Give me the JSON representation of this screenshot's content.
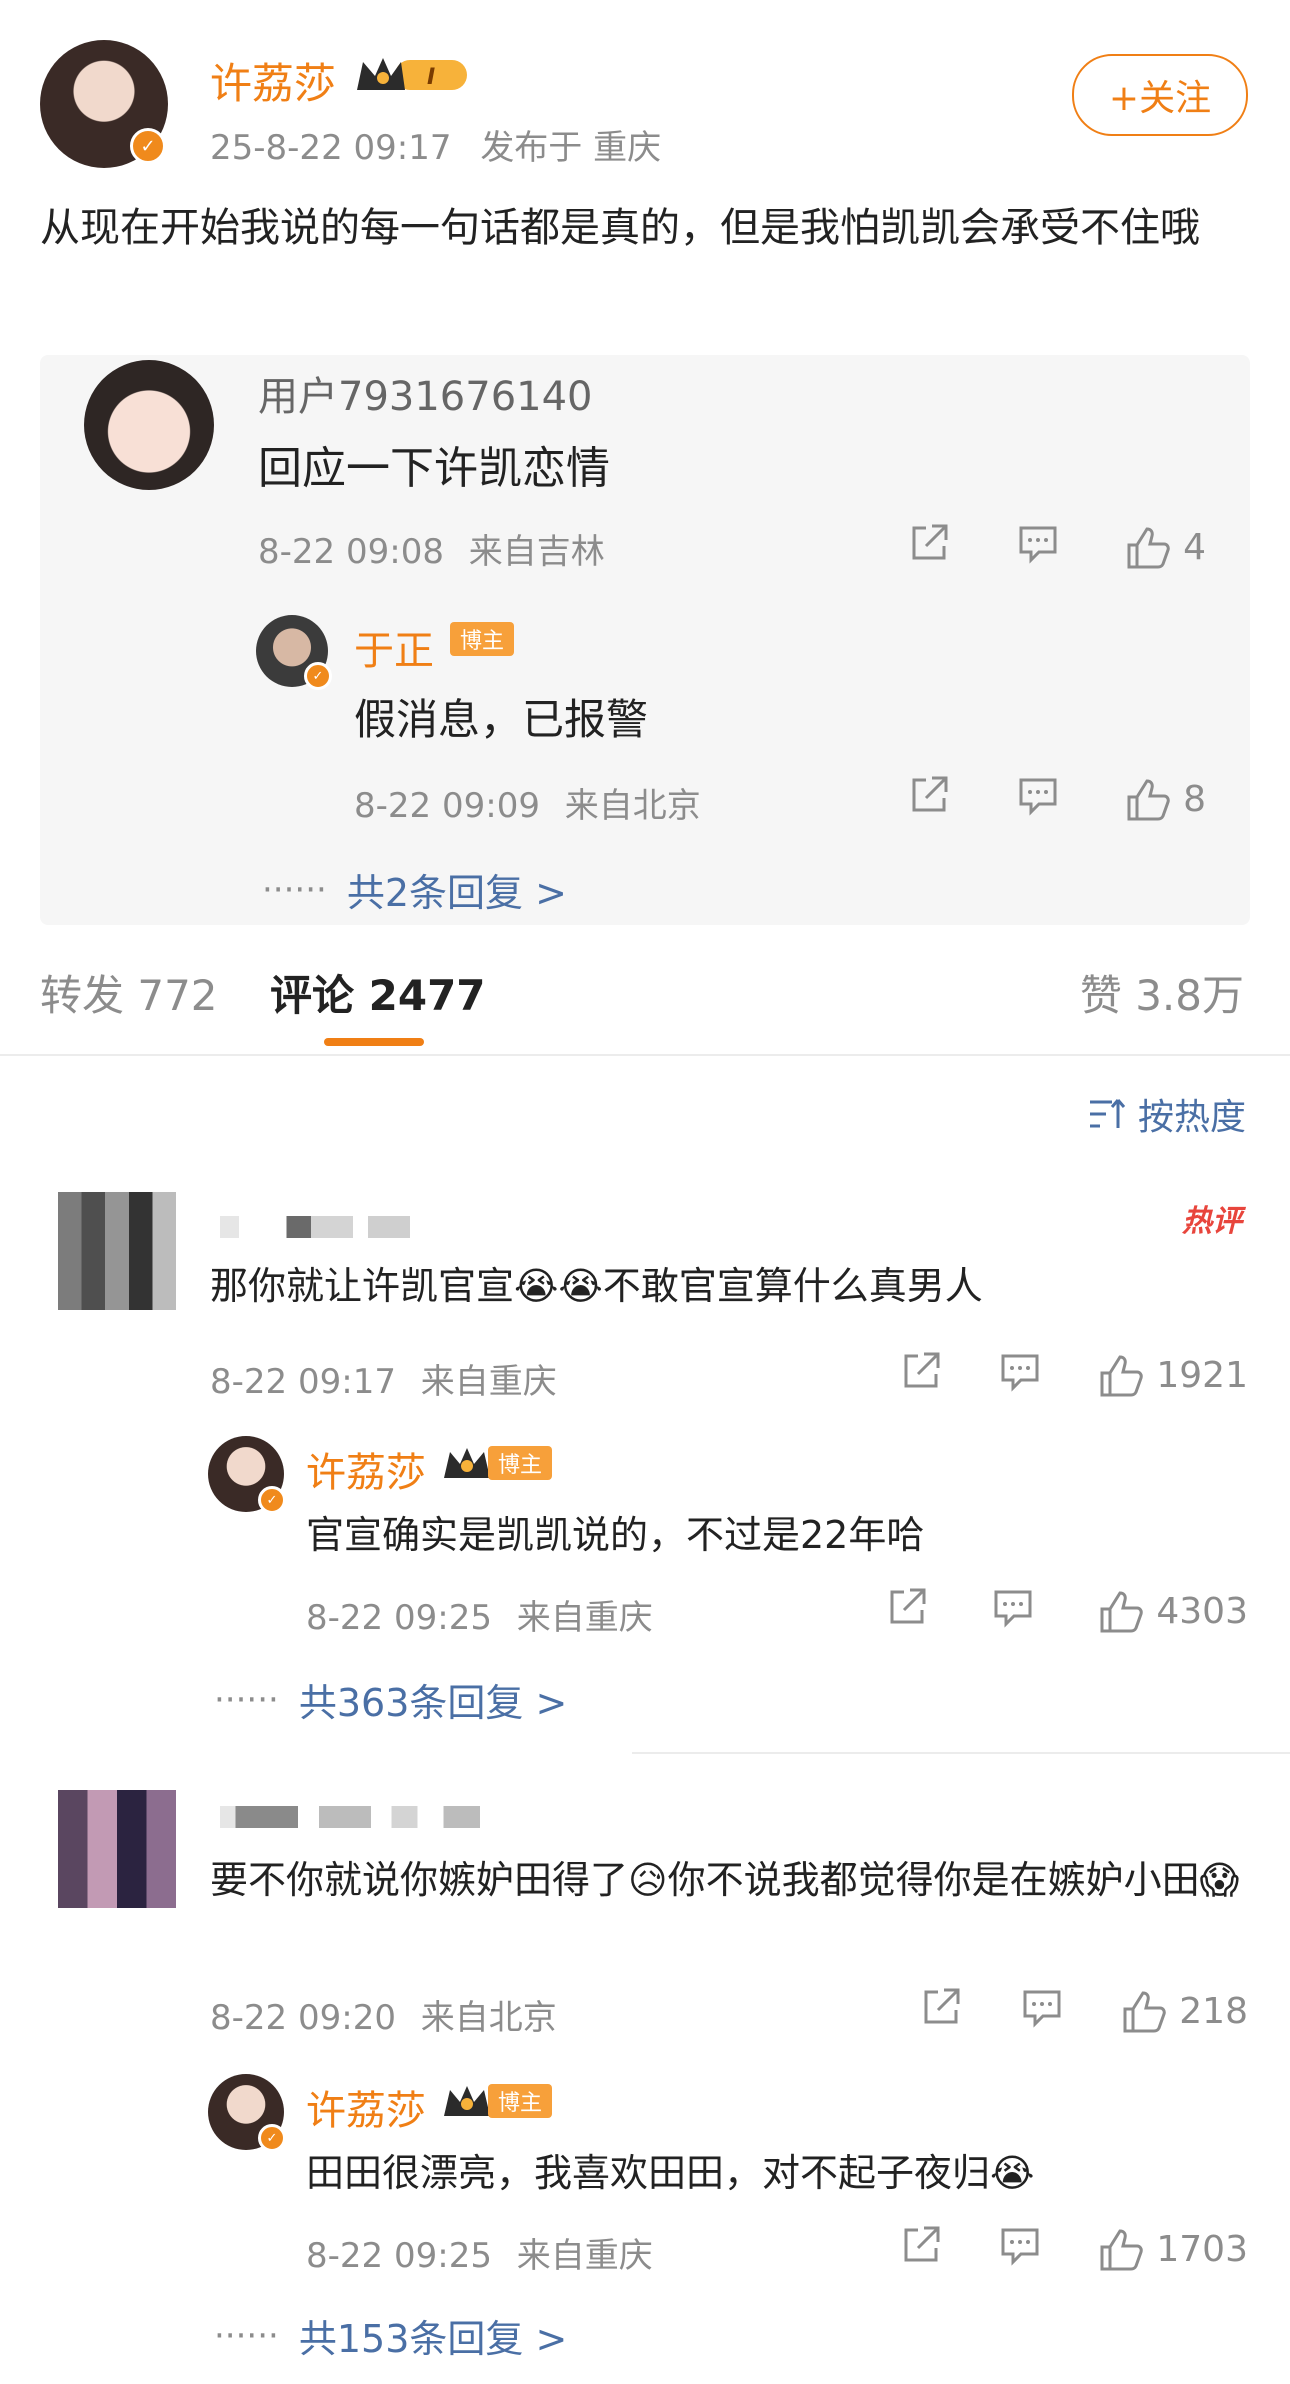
{
  "post": {
    "author": "许荔莎",
    "meta_time": "25-8-22 09:17",
    "meta_loc": "发布于 重庆",
    "follow_label": "+关注",
    "text": "从现在开始我说的每一句话都是真的，但是我怕凯凯会承受不住哦"
  },
  "quote": {
    "user": "用户7931676140",
    "text": "回应一下许凯恋情",
    "time": "8-22 09:08",
    "from": "来自吉林",
    "likes": "4",
    "reply": {
      "user": "于正",
      "badge": "博主",
      "text": "假消息，已报警",
      "time": "8-22 09:09",
      "from": "来自北京",
      "likes": "8"
    },
    "more": "共2条回复 >"
  },
  "tabs": {
    "repost": "转发 772",
    "comment": "评论 2477",
    "like": "赞 3.8万"
  },
  "sort_label": "按热度",
  "comments": [
    {
      "text": "那你就让许凯官宣😭😭不敢官宣算什么真男人",
      "hot": "热评",
      "time": "8-22 09:17",
      "from": "来自重庆",
      "likes": "1921",
      "reply": {
        "user": "许荔莎",
        "badge": "博主",
        "text": "官宣确实是凯凯说的，不过是22年哈",
        "time": "8-22 09:25",
        "from": "来自重庆",
        "likes": "4303"
      },
      "more": "共363条回复 >"
    },
    {
      "text": "要不你就说你嫉妒田得了😥你不说我都觉得你是在嫉妒小田😱",
      "time": "8-22 09:20",
      "from": "来自北京",
      "likes": "218",
      "reply": {
        "user": "许荔莎",
        "badge": "博主",
        "text": "田田很漂亮，我喜欢田田，对不起子夜归😭",
        "time": "8-22 09:25",
        "from": "来自重庆",
        "likes": "1703"
      },
      "more": "共153条回复 >"
    }
  ]
}
